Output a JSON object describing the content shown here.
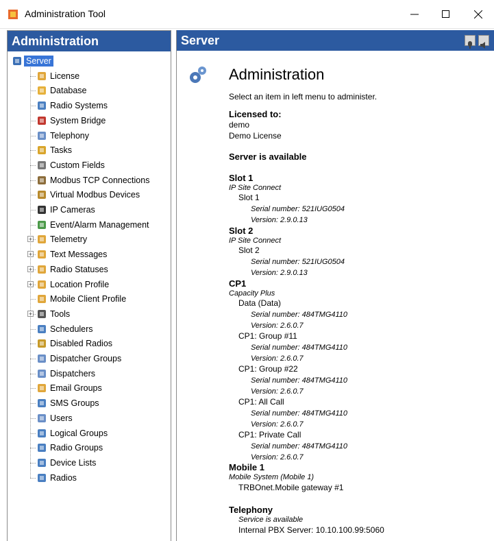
{
  "window": {
    "title": "Administration Tool",
    "min_glyph": "—",
    "max_glyph": "☐",
    "close_glyph": "✕"
  },
  "left": {
    "header": "Administration",
    "items": [
      {
        "label": "Server",
        "icon": "server-icon",
        "selected": true
      },
      {
        "label": "License",
        "icon": "license-icon"
      },
      {
        "label": "Database",
        "icon": "database-icon"
      },
      {
        "label": "Radio Systems",
        "icon": "radio-systems-icon"
      },
      {
        "label": "System Bridge",
        "icon": "system-bridge-icon"
      },
      {
        "label": "Telephony",
        "icon": "telephony-icon"
      },
      {
        "label": "Tasks",
        "icon": "tasks-icon"
      },
      {
        "label": "Custom Fields",
        "icon": "custom-fields-icon"
      },
      {
        "label": "Modbus TCP Connections",
        "icon": "modbus-icon"
      },
      {
        "label": "Virtual Modbus Devices",
        "icon": "virtual-modbus-icon"
      },
      {
        "label": "IP Cameras",
        "icon": "ip-camera-icon"
      },
      {
        "label": "Event/Alarm Management",
        "icon": "event-alarm-icon"
      },
      {
        "label": "Telemetry",
        "icon": "telemetry-icon",
        "expandable": true
      },
      {
        "label": "Text Messages",
        "icon": "text-messages-icon",
        "expandable": true
      },
      {
        "label": "Radio Statuses",
        "icon": "radio-statuses-icon",
        "expandable": true
      },
      {
        "label": "Location Profile",
        "icon": "location-profile-icon",
        "expandable": true
      },
      {
        "label": "Mobile Client Profile",
        "icon": "mobile-client-icon"
      },
      {
        "label": "Tools",
        "icon": "tools-icon",
        "expandable": true
      },
      {
        "label": "Schedulers",
        "icon": "clock-icon"
      },
      {
        "label": "Disabled Radios",
        "icon": "lock-icon"
      },
      {
        "label": "Dispatcher Groups",
        "icon": "dispatcher-groups-icon"
      },
      {
        "label": "Dispatchers",
        "icon": "dispatchers-icon"
      },
      {
        "label": "Email Groups",
        "icon": "email-icon"
      },
      {
        "label": "SMS Groups",
        "icon": "sms-icon"
      },
      {
        "label": "Users",
        "icon": "users-icon"
      },
      {
        "label": "Logical Groups",
        "icon": "logical-groups-icon"
      },
      {
        "label": "Radio Groups",
        "icon": "radio-groups-icon"
      },
      {
        "label": "Device Lists",
        "icon": "device-lists-icon"
      },
      {
        "label": "Radios",
        "icon": "radios-icon"
      }
    ]
  },
  "right": {
    "header": "Server",
    "title": "Administration",
    "subtitle": "Select an item in left menu to administer.",
    "licensed_to_label": "Licensed to:",
    "licensee": "demo",
    "license_name": "Demo License",
    "server_status": "Server is available",
    "slot1": {
      "title": "Slot 1",
      "type": "IP Site Connect",
      "name": "Slot 1",
      "serial": "Serial number:  521IUG0504",
      "version": "Version:  2.9.0.13"
    },
    "slot2": {
      "title": "Slot 2",
      "type": "IP Site Connect",
      "name": "Slot 2",
      "serial": "Serial number:  521IUG0504",
      "version": "Version:  2.9.0.13"
    },
    "cp1": {
      "title": "CP1",
      "type": "Capacity Plus",
      "channels": [
        {
          "name": "Data (Data)",
          "serial": "Serial number:  484TMG4110",
          "version": "Version:  2.6.0.7"
        },
        {
          "name": "CP1: Group #11",
          "serial": "Serial number:  484TMG4110",
          "version": "Version:  2.6.0.7"
        },
        {
          "name": "CP1: Group #22",
          "serial": "Serial number:  484TMG4110",
          "version": "Version:  2.6.0.7"
        },
        {
          "name": "CP1: All Call",
          "serial": "Serial number:  484TMG4110",
          "version": "Version:  2.6.0.7"
        },
        {
          "name": "CP1: Private Call",
          "serial": "Serial number:  484TMG4110",
          "version": "Version:  2.6.0.7"
        }
      ]
    },
    "mobile1": {
      "title": "Mobile 1",
      "type": "Mobile System (Mobile 1)",
      "gateway": "TRBOnet.Mobile gateway #1"
    },
    "telephony": {
      "title": "Telephony",
      "status": "Service is available",
      "pbx": "Internal PBX Server: 10.10.100.99:5060"
    }
  },
  "colors": {
    "header_blue": "#2c5aa0",
    "selection": "#3875d7"
  }
}
